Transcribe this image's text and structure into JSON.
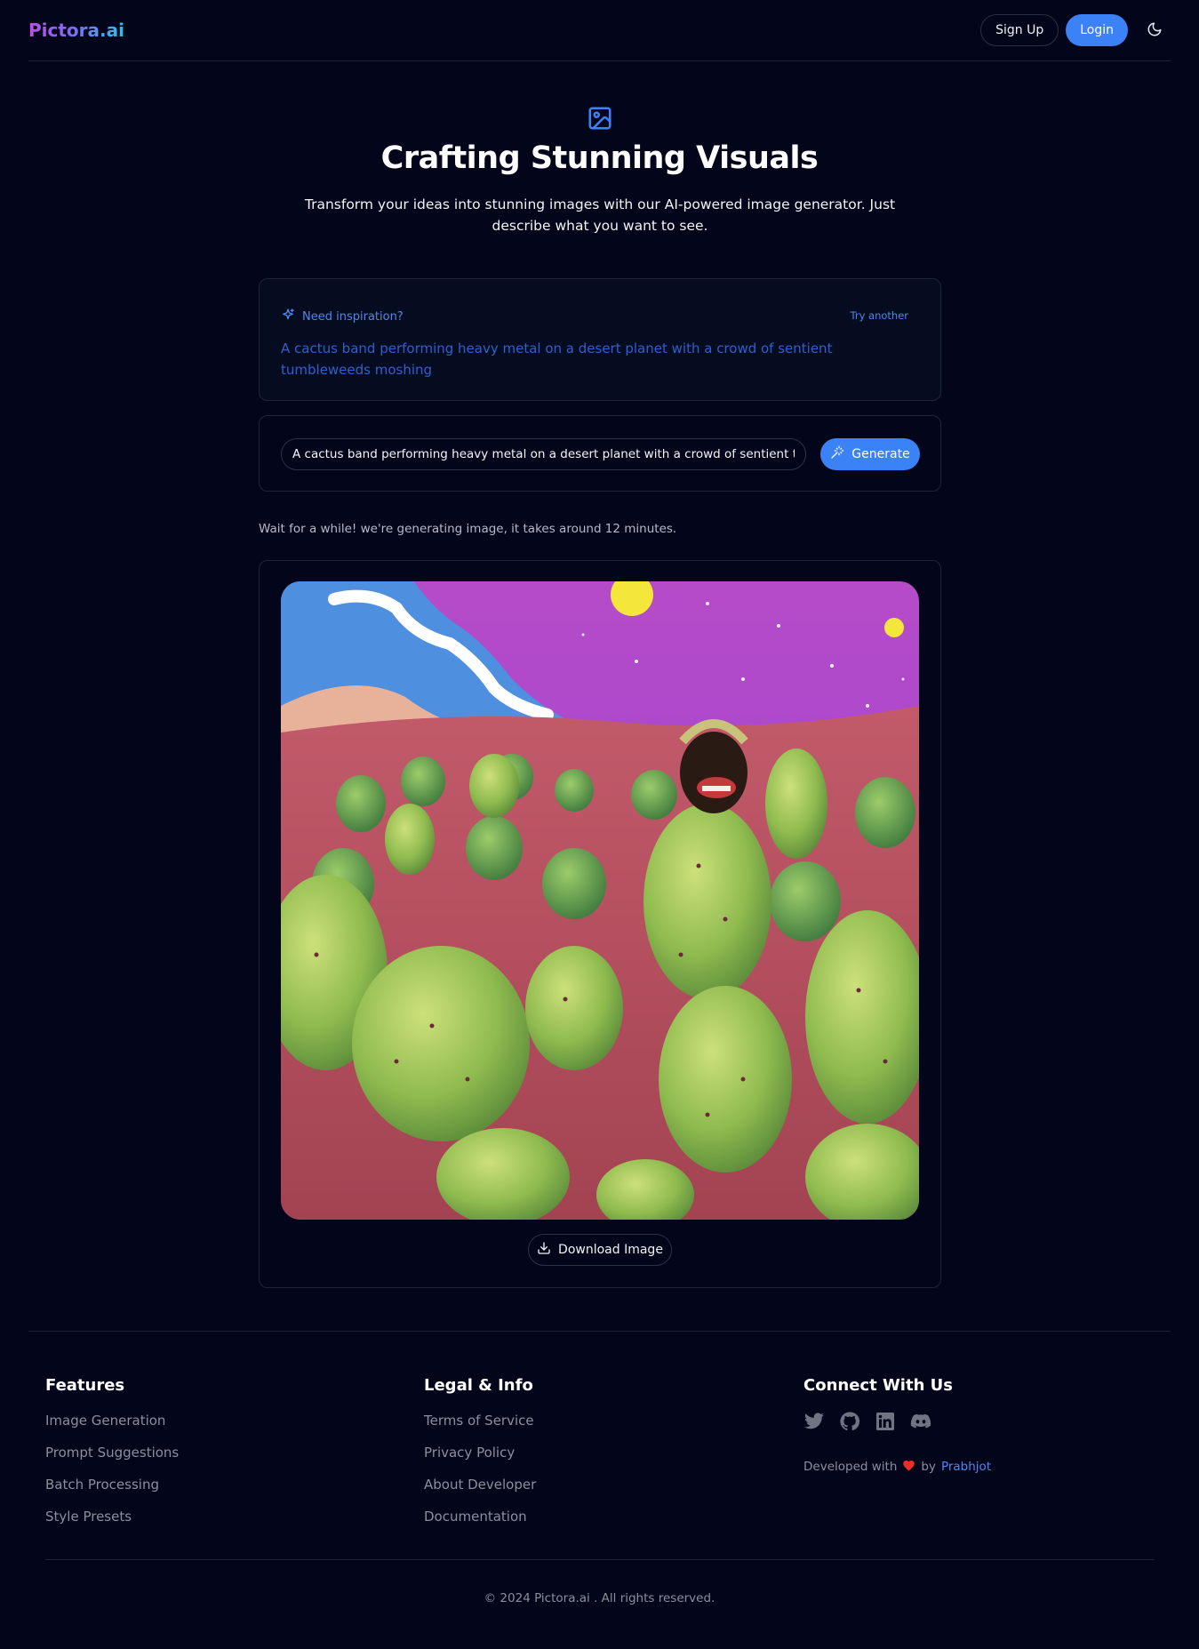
{
  "header": {
    "brand": "Pictora.ai",
    "signup_label": "Sign Up",
    "login_label": "Login",
    "theme_icon": "moon-icon"
  },
  "hero": {
    "icon": "image-icon",
    "title": "Crafting Stunning Visuals",
    "subtitle": "Transform your ideas into stunning images with our AI-powered image generator. Just describe what you want to see."
  },
  "inspiration": {
    "icon": "sparkles-icon",
    "label": "Need inspiration?",
    "try_another": "Try another",
    "suggestion": "A cactus band performing heavy metal on a desert planet with a crowd of sentient tumbleweeds moshing"
  },
  "prompt": {
    "value": "A cactus band performing heavy metal on a desert planet with a crowd of sentient tumbleweeds moshing",
    "placeholder": "",
    "generate_label": "Generate",
    "generate_icon": "wand-icon"
  },
  "status": {
    "message": "Wait for a while! we're generating image, it takes around 12 minutes."
  },
  "result": {
    "image_alt": "Generated image of green prickly pear cacti on a red desert under a purple starry sky",
    "download_label": "Download Image",
    "download_icon": "download-icon"
  },
  "footer": {
    "features": {
      "title": "Features",
      "links": [
        "Image Generation",
        "Prompt Suggestions",
        "Batch Processing",
        "Style Presets"
      ]
    },
    "legal": {
      "title": "Legal & Info",
      "links": [
        "Terms of Service",
        "Privacy Policy",
        "About Developer",
        "Documentation"
      ]
    },
    "connect": {
      "title": "Connect With Us",
      "social_icons": [
        "twitter-icon",
        "github-icon",
        "linkedin-icon",
        "discord-icon"
      ],
      "dev_prefix": "Developed with",
      "dev_by": "by",
      "dev_name": "Prabhjot"
    },
    "copyright": "© 2024 Pictora.ai . All rights reserved."
  },
  "colors": {
    "background": "#03061a",
    "accent": "#3b82f6",
    "link": "#4f86f0",
    "heart": "#ef2b2b"
  }
}
